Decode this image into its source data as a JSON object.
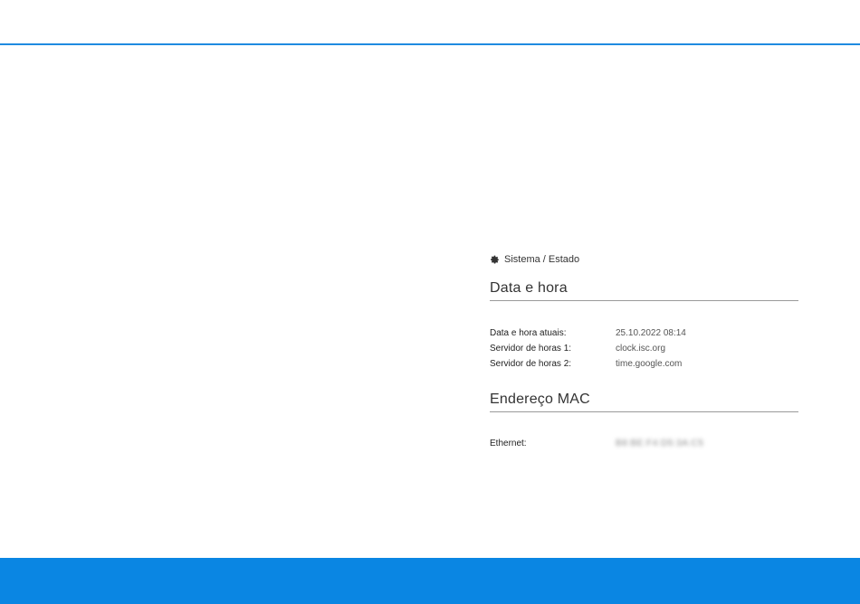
{
  "breadcrumb": {
    "icon": "gear-icon",
    "text": "Sistema / Estado"
  },
  "datetime_section": {
    "title": "Data e hora",
    "rows": [
      {
        "label": "Data e hora atuais:",
        "value": "25.10.2022 08:14"
      },
      {
        "label": "Servidor de horas 1:",
        "value": "clock.isc.org"
      },
      {
        "label": "Servidor de horas 2:",
        "value": "time.google.com"
      }
    ]
  },
  "mac_section": {
    "title": "Endereço MAC",
    "rows": [
      {
        "label": "Ethernet:",
        "value": "B8:BE:F4:D5:3A:C5"
      }
    ]
  },
  "colors": {
    "accent": "#1f8be0",
    "footer": "#0a86e3"
  }
}
